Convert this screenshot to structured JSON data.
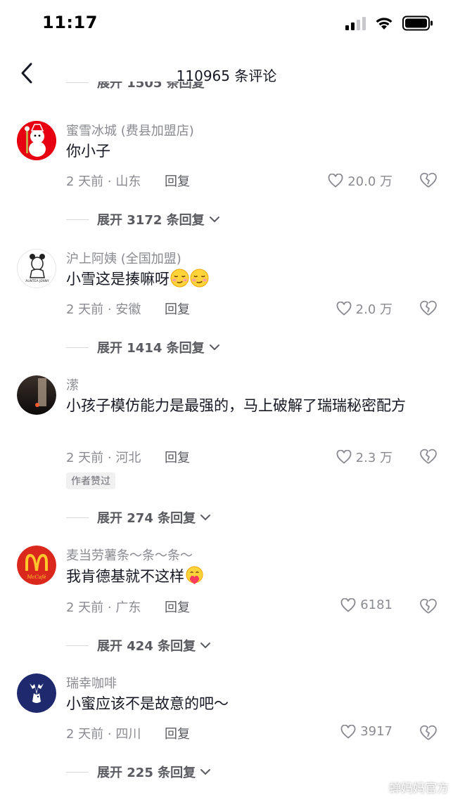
{
  "status": {
    "time": "11:17"
  },
  "header": {
    "title": "110965 条评论"
  },
  "partial_expand": "展开 1505 条回复",
  "comments": [
    {
      "name": "蜜雪冰城 (费县加盟店)",
      "text": "你小子",
      "time_loc": "2 天前 · 山东",
      "reply": "回复",
      "likes": "20.0 万",
      "expand": "展开 3172 条回复",
      "avatar_color": "#e60012"
    },
    {
      "name": "沪上阿姨 (全国加盟)",
      "text": "小雪这是揍嘛呀",
      "emoji": [
        "smirk-face",
        "smirk-face"
      ],
      "time_loc": "2 天前 · 安徽",
      "reply": "回复",
      "likes": "2.0 万",
      "expand": "展开 1414 条回复",
      "avatar_color": "#ffffff"
    },
    {
      "name": "潆",
      "text": "小孩子模仿能力是最强的，马上破解了瑞瑞秘密配方",
      "time_loc": "2 天前 · 河北",
      "reply": "回复",
      "likes": "2.3 万",
      "author_tag": "作者赞过",
      "expand": "展开 274 条回复",
      "avatar_color": "#1a1414"
    },
    {
      "name": "麦当劳薯条～条～条～",
      "text": "我肯德基就不这样",
      "emoji": [
        "love-heart-face"
      ],
      "time_loc": "2 天前 · 广东",
      "reply": "回复",
      "likes": "6181",
      "expand": "展开 424 条回复",
      "avatar_color": "#da291c"
    },
    {
      "name": "瑞幸咖啡",
      "text": "小蜜应该不是故意的吧～",
      "time_loc": "2 天前 · 四川",
      "reply": "回复",
      "likes": "3917",
      "expand": "展开 225 条回复",
      "avatar_color": "#1f2a6e"
    }
  ],
  "watermark": "蝉妈妈官方",
  "colors": {
    "text": "#161823",
    "secondary": "#8a8b91",
    "like_icon": "#8a8b91"
  }
}
